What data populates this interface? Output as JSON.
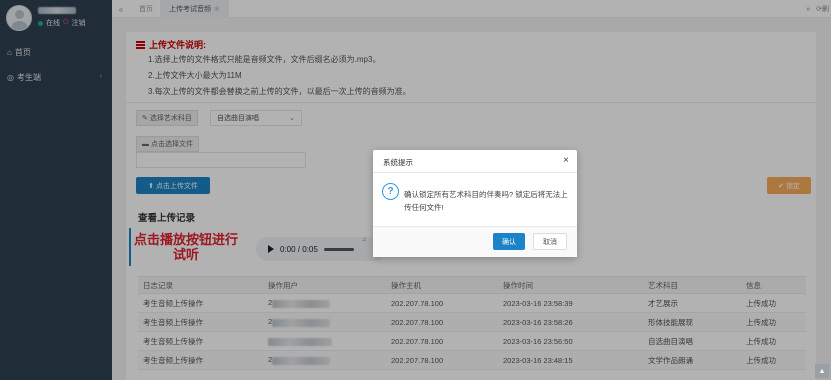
{
  "sidebar": {
    "user": {
      "status": "在线",
      "logout": "注销"
    },
    "nav": [
      {
        "label": "首页",
        "icon": "home-icon"
      },
      {
        "label": "考生端",
        "icon": "user-icon"
      }
    ]
  },
  "tabbar": {
    "tabs": [
      {
        "label": "首页"
      },
      {
        "label": "上传考试音频"
      }
    ],
    "refresh": "刷"
  },
  "upload": {
    "title": "上传文件说明:",
    "lines": [
      "1.选择上传的文件格式只能是音频文件，文件后缀名必须为.mp3。",
      "2.上传文件大小最大为11M",
      "3.每次上传的文件都会替换之前上传的文件，以最后一次上传的音频为准。"
    ],
    "subject_label": "选择艺术科目",
    "subject_value": "自选曲目演唱",
    "file_label": "点击选择文件",
    "upload_button": "点击上传文件",
    "lock_button": "锁定"
  },
  "records": {
    "title": "查看上传记录",
    "hint": "点击播放按钮进行试听",
    "player_time": "0:00 / 0:05",
    "columns": [
      "日志记录",
      "操作用户",
      "操作主机",
      "操作时间",
      "艺术科目",
      "信息"
    ],
    "rows": [
      {
        "log": "考生音频上传操作",
        "user": "2",
        "host": "202.207.78.100",
        "time": "2023-03-16 23:58:39",
        "subject": "才艺展示",
        "info": "上传成功"
      },
      {
        "log": "考生音频上传操作",
        "user": "2",
        "host": "202.207.78.100",
        "time": "2023-03-16 23:58:26",
        "subject": "形体技能展现",
        "info": "上传成功"
      },
      {
        "log": "考生音频上传操作",
        "user": "",
        "host": "202.207.78.100",
        "time": "2023-03-16 23:56:50",
        "subject": "自选曲目演唱",
        "info": "上传成功"
      },
      {
        "log": "考生音频上传操作",
        "user": "2",
        "host": "202.207.78.100",
        "time": "2023-03-16 23:48:15",
        "subject": "文学作品朗诵",
        "info": "上传成功"
      }
    ]
  },
  "dialog": {
    "title": "系统提示",
    "message": "确认锁定所有艺术科目的伴奏吗? 锁定后将无法上传任何文件!",
    "ok": "确认",
    "cancel": "取消"
  },
  "colors": {
    "sidebar": "#2f4050",
    "primary": "#1c84c6",
    "warning": "#f8ac59",
    "accent_red": "#e0212f"
  }
}
